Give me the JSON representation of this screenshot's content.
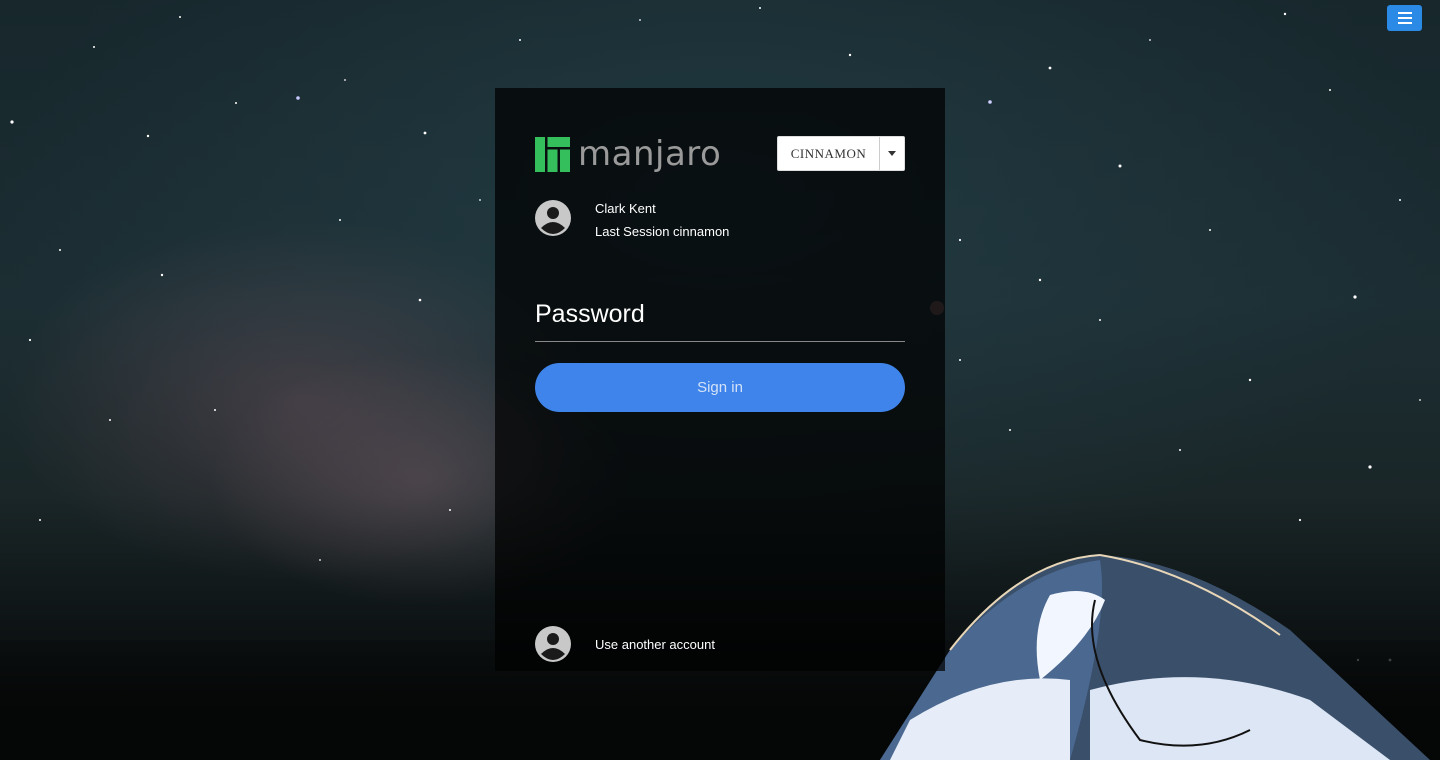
{
  "menu": {
    "icon": "hamburger-menu-icon"
  },
  "brand": {
    "name": "manjaro",
    "logo_icon": "manjaro-logo-icon",
    "logo_color": "#35bf5c"
  },
  "session": {
    "selected": "CINNAMON",
    "caret_icon": "caret-down-icon"
  },
  "user": {
    "name": "Clark Kent",
    "last_session": "Last Session cinnamon",
    "avatar_icon": "account-circle-icon"
  },
  "password": {
    "placeholder": "Password",
    "value": ""
  },
  "signin": {
    "label": "Sign in",
    "color": "#3f84ea"
  },
  "other_account": {
    "label": "Use another account",
    "icon": "account-circle-icon"
  },
  "colors": {
    "menu_button": "#2a8ae6",
    "panel_background": "rgba(0,0,0,0.72)"
  }
}
